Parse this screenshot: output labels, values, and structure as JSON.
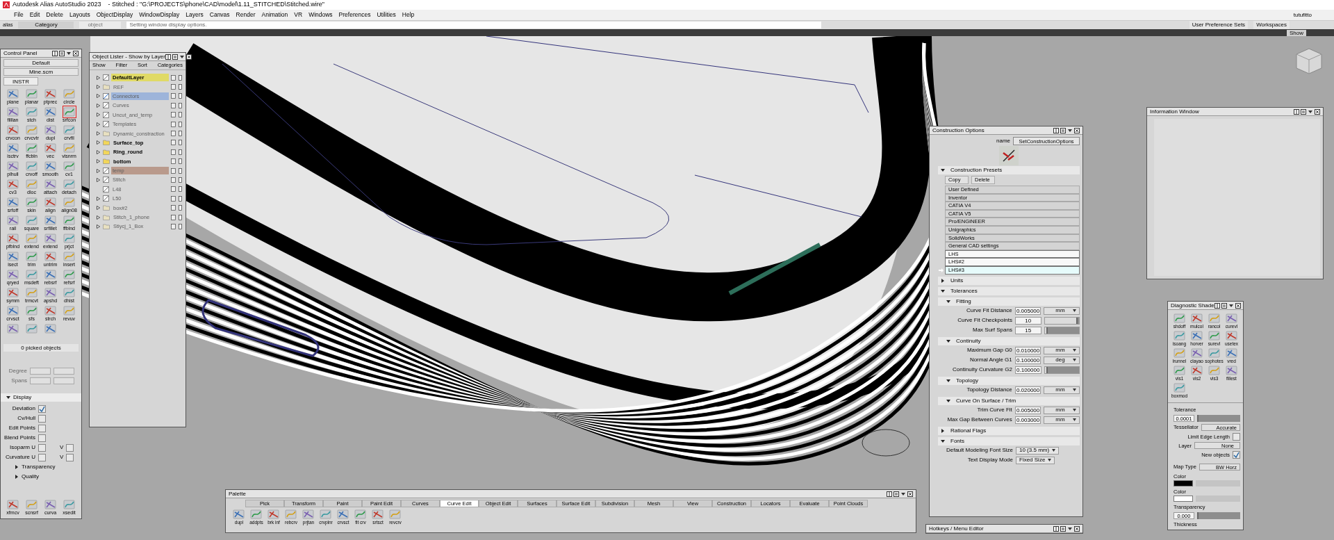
{
  "window": {
    "title": "Autodesk Alias AutoStudio 2023    - Stitched : \"G:\\PROJECTS\\phone\\CAD\\model\\1.11_STITCHED\\Stitched.wire\""
  },
  "menu": [
    "File",
    "Edit",
    "Delete",
    "Layouts",
    "ObjectDisplay",
    "WindowDisplay",
    "Layers",
    "Canvas",
    "Render",
    "Animation",
    "VR",
    "Windows",
    "Preferences",
    "Utilities",
    "Help"
  ],
  "toolbar": {
    "logo_label": "alias",
    "category": "Category",
    "object": "object",
    "status": "Setting window display options.",
    "preference_sets": "User Preference Sets",
    "workspaces": "Workspaces",
    "user": "tutufitto",
    "show": "Show"
  },
  "control_panel": {
    "title": "Control Panel",
    "preset": "Default",
    "file": "Mine.scm",
    "tab": "INSTR",
    "tools": [
      {
        "label": "plane",
        "selected": false
      },
      {
        "label": "planar",
        "selected": false
      },
      {
        "label": "ptprec",
        "selected": false
      },
      {
        "label": "circle",
        "selected": false
      },
      {
        "label": "filllan",
        "selected": false
      },
      {
        "label": "stch",
        "selected": false
      },
      {
        "label": "dist",
        "selected": false
      },
      {
        "label": "srfcon",
        "selected": true
      },
      {
        "label": "crvcon",
        "selected": false
      },
      {
        "label": "crvcvtr",
        "selected": false
      },
      {
        "label": "dupl",
        "selected": false
      },
      {
        "label": "crvfil",
        "selected": false
      },
      {
        "label": "isctrv",
        "selected": false
      },
      {
        "label": "ffcbln",
        "selected": false
      },
      {
        "label": "vec",
        "selected": false
      },
      {
        "label": "visnrm",
        "selected": false
      },
      {
        "label": "plhull",
        "selected": false
      },
      {
        "label": "crvoff",
        "selected": false
      },
      {
        "label": "smooth",
        "selected": false
      },
      {
        "label": "cv1",
        "selected": false
      },
      {
        "label": "cv3",
        "selected": false
      },
      {
        "label": "dloc",
        "selected": false
      },
      {
        "label": "attach",
        "selected": false
      },
      {
        "label": "detach",
        "selected": false
      },
      {
        "label": "srfoff",
        "selected": false
      },
      {
        "label": "skin",
        "selected": false
      },
      {
        "label": "align",
        "selected": false
      },
      {
        "label": "align08",
        "selected": false
      },
      {
        "label": "rail",
        "selected": false
      },
      {
        "label": "square",
        "selected": false
      },
      {
        "label": "srfillet",
        "selected": false
      },
      {
        "label": "ffblnd",
        "selected": false
      },
      {
        "label": "pfblnd",
        "selected": false
      },
      {
        "label": "extend",
        "selected": false
      },
      {
        "label": "extend",
        "selected": false
      },
      {
        "label": "prjct",
        "selected": false
      },
      {
        "label": "isect",
        "selected": false
      },
      {
        "label": "trim",
        "selected": false
      },
      {
        "label": "untrim",
        "selected": false
      },
      {
        "label": "insert",
        "selected": false
      },
      {
        "label": "qryed",
        "selected": false
      },
      {
        "label": "msdeft",
        "selected": false
      },
      {
        "label": "rebsrf",
        "selected": false
      },
      {
        "label": "refsrf",
        "selected": false
      },
      {
        "label": "symm",
        "selected": false
      },
      {
        "label": "trmcvt",
        "selected": false
      },
      {
        "label": "apshd",
        "selected": false
      },
      {
        "label": "dhist",
        "selected": false
      },
      {
        "label": "crvsct",
        "selected": false
      },
      {
        "label": "sfs",
        "selected": false
      },
      {
        "label": "strch",
        "selected": false
      },
      {
        "label": "revuv",
        "selected": false
      },
      {
        "selected": false
      },
      {
        "selected": false
      },
      {
        "selected": false
      }
    ],
    "picked": "0 picked objects",
    "degree": "Degree",
    "spans": "Spans",
    "display": {
      "title": "Display",
      "expanded": true,
      "options": [
        {
          "label": "Deviation",
          "checked": true
        },
        {
          "label": "Cv/Hull",
          "checked": false
        },
        {
          "label": "Edit Points",
          "checked": false
        },
        {
          "label": "Blend Points",
          "checked": false
        },
        {
          "label": "Isoparm U",
          "checked": false,
          "v_label": "V",
          "v_checked": false
        },
        {
          "label": "Curvature U",
          "checked": false,
          "v_label": "V",
          "v_checked": false
        }
      ],
      "subsections": [
        {
          "label": "Transparency",
          "expanded": false
        },
        {
          "label": "Quality",
          "expanded": false
        }
      ]
    },
    "bottom_tools": [
      "xfmcv",
      "scnsrf",
      "curva",
      "xsedit"
    ]
  },
  "object_lister": {
    "title": "Object Lister - Show by Layer",
    "menu": [
      "Show",
      "Filter",
      "Sort",
      "Categories"
    ],
    "rows": [
      {
        "name": "DefaultLayer",
        "kind": "layer",
        "dimmed": false,
        "expandable": true,
        "color": "#e0da66"
      },
      {
        "name": "REF",
        "kind": "folder",
        "dimmed": true,
        "expandable": true
      },
      {
        "name": "Connectors",
        "kind": "layer",
        "dimmed": true,
        "expandable": true,
        "color": "#9db4da"
      },
      {
        "name": "Curves",
        "kind": "layer",
        "dimmed": true,
        "expandable": true
      },
      {
        "name": "Uncut_and_temp",
        "kind": "layer",
        "dimmed": true,
        "expandable": true
      },
      {
        "name": "Templates",
        "kind": "layer",
        "dimmed": true,
        "expandable": true
      },
      {
        "name": "Dynamic_constraction",
        "kind": "folder",
        "dimmed": true,
        "expandable": true
      },
      {
        "name": "Surface_top",
        "kind": "folder",
        "dimmed": false,
        "expandable": true
      },
      {
        "name": "Ring_round",
        "kind": "folder",
        "dimmed": false,
        "expandable": true
      },
      {
        "name": "bottom",
        "kind": "folder",
        "dimmed": false,
        "expandable": true
      },
      {
        "name": "temp",
        "kind": "layer",
        "dimmed": true,
        "expandable": true,
        "color": "#b99a8c"
      },
      {
        "name": "Stitch",
        "kind": "layer",
        "dimmed": true,
        "expandable": true
      },
      {
        "name": "L48",
        "kind": "layer",
        "dimmed": true,
        "expandable": false
      },
      {
        "name": "L50",
        "kind": "layer",
        "dimmed": true,
        "expandable": true
      },
      {
        "name": "box#2",
        "kind": "folder",
        "dimmed": true,
        "expandable": true
      },
      {
        "name": "Stitch_1_phone",
        "kind": "folder",
        "dimmed": true,
        "expandable": true
      },
      {
        "name": "Stiycj_1_Box",
        "kind": "folder",
        "dimmed": true,
        "expandable": true
      }
    ]
  },
  "construction_options": {
    "title": "Construction Options",
    "name_label": "name",
    "name_value": "SetConstructionOptions",
    "presets": {
      "title": "Construction Presets",
      "expanded": true,
      "buttons": [
        "Copy",
        "Delete"
      ],
      "items": [
        {
          "label": "User Defined",
          "kind": "builtin",
          "selected": false
        },
        {
          "label": "Inventor",
          "kind": "builtin",
          "selected": false
        },
        {
          "label": "CATIA V4",
          "kind": "builtin",
          "selected": false
        },
        {
          "label": "CATIA V5",
          "kind": "builtin",
          "selected": false
        },
        {
          "label": "Pro/ENGINEER",
          "kind": "builtin",
          "selected": false
        },
        {
          "label": "Unigraphics",
          "kind": "builtin",
          "selected": false
        },
        {
          "label": "SolidWorks",
          "kind": "builtin",
          "selected": false
        },
        {
          "label": "General CAD settings",
          "kind": "builtin",
          "selected": false
        },
        {
          "label": "LHS",
          "kind": "user",
          "selected": false
        },
        {
          "label": "LHS#2",
          "kind": "user",
          "selected": false
        },
        {
          "label": "LHS#3",
          "kind": "user",
          "selected": true
        }
      ]
    },
    "sections": [
      {
        "title": "Units",
        "expanded": false
      },
      {
        "title": "Tolerances",
        "expanded": true,
        "groups": [
          {
            "title": "Fitting",
            "expanded": true,
            "fields": [
              {
                "label": "Curve Fit Distance",
                "kind": "unit",
                "value": "0.005000",
                "unit": "mm"
              },
              {
                "label": "Curve Fit Checkpoints",
                "kind": "slider",
                "value": "10",
                "level": 0.95
              },
              {
                "label": "Max Surf Spans",
                "kind": "slider",
                "value": "15",
                "level": 0.1
              }
            ]
          },
          {
            "title": "Continuity",
            "expanded": true,
            "fields": [
              {
                "label": "Maximum Gap G0",
                "kind": "unit",
                "value": "0.010000",
                "unit": "mm"
              },
              {
                "label": "Normal Angle G1",
                "kind": "unit",
                "value": "0.100000",
                "unit": "deg"
              },
              {
                "label": "Continuity Curvature G2",
                "kind": "slider",
                "value": "0.100000",
                "level": 0.1
              }
            ]
          },
          {
            "title": "Topology",
            "expanded": true,
            "fields": [
              {
                "label": "Topology Distance",
                "kind": "unit",
                "value": "0.020000",
                "unit": "mm"
              }
            ]
          },
          {
            "title": "Curve On Surface / Trim",
            "expanded": true,
            "fields": [
              {
                "label": "Trim Curve Fit",
                "kind": "unit",
                "value": "0.005000",
                "unit": "mm"
              },
              {
                "label": "Max Gap Between Curves",
                "kind": "unit",
                "value": "0.003000",
                "unit": "mm"
              }
            ]
          }
        ]
      },
      {
        "title": "Rational Flags",
        "expanded": false
      },
      {
        "title": "Fonts",
        "expanded": true,
        "fields": [
          {
            "label": "Default Modeling Font Size",
            "kind": "dropdown",
            "value": "10 (3.5 mm)"
          },
          {
            "label": "Text Display Mode",
            "kind": "dropdown",
            "value": "Fixed Size"
          }
        ]
      }
    ]
  },
  "info_window": {
    "title": "Information Window"
  },
  "diagnostic_shade": {
    "title": "Diagnostic Shade",
    "tools": [
      "shdoff",
      "mulcol",
      "rancol",
      "curevl",
      "isoang",
      "horver",
      "surevl",
      "usetex",
      "lrunnel",
      "clayao",
      "sophotes",
      "vred",
      "vis1",
      "vis2",
      "vis3",
      "fillest",
      "boxmod"
    ],
    "tolerance_label": "Tolerance",
    "tolerance": "0.0001",
    "tolerance_slider": {
      "level": 0.02
    },
    "tessellator_label": "Tessellator",
    "tessellator": "Accurate",
    "limit_label": "Limit Edge Length",
    "limit_checked": false,
    "layer_label": "Layer",
    "layer": "None",
    "new_objects_label": "New objects",
    "new_objects_checked": true,
    "map_type_label": "Map Type",
    "map_type": "BW Horz",
    "colors": [
      {
        "label": "Color",
        "color": "#000000"
      },
      {
        "label": "Color",
        "color": "#ffffff"
      }
    ],
    "transparency_label": "Transparency",
    "transparency": "0.000",
    "transparency_slider": {
      "level": 0.02
    },
    "thickness_label": "Thickness"
  },
  "palette": {
    "title": "Palette",
    "tabs": [
      {
        "label": "Pick",
        "selected": false
      },
      {
        "label": "Transform",
        "selected": false
      },
      {
        "label": "Paint",
        "selected": false
      },
      {
        "label": "Paint Edit",
        "selected": false
      },
      {
        "label": "Curves",
        "selected": false
      },
      {
        "label": "Curve Edit",
        "selected": true
      },
      {
        "label": "Object Edit",
        "selected": false
      },
      {
        "label": "Surfaces",
        "selected": false
      },
      {
        "label": "Surface Edit",
        "selected": false
      },
      {
        "label": "Subdivision",
        "selected": false
      },
      {
        "label": "Mesh",
        "selected": false
      },
      {
        "label": "View",
        "selected": false
      },
      {
        "label": "Construction",
        "selected": false
      },
      {
        "label": "Locators",
        "selected": false
      },
      {
        "label": "Evaluate",
        "selected": false
      },
      {
        "label": "Point Clouds",
        "selected": false
      }
    ],
    "tools": [
      "dupl",
      "addpts",
      "brk inf",
      "rebcrv",
      "prjtan",
      "crvplnr",
      "crvsct",
      "fit crv",
      "srtsct",
      "revcrv"
    ]
  },
  "hotkeys": {
    "title": "Hotkeys / Menu Editor"
  }
}
